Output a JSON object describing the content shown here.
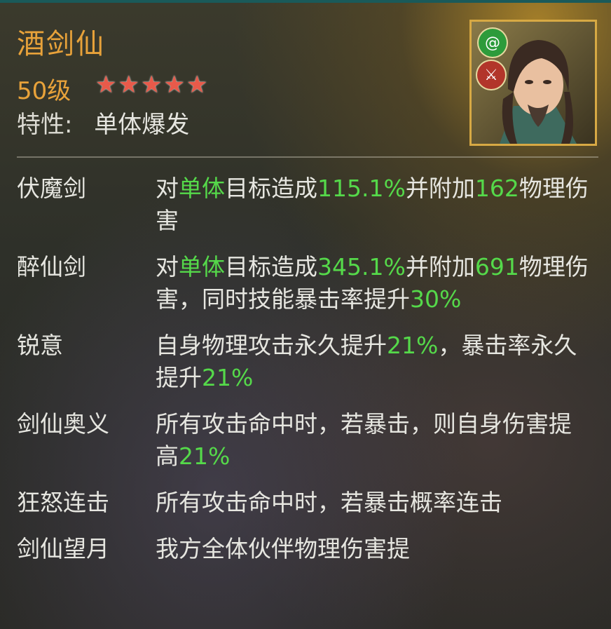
{
  "hero": {
    "name": "酒剑仙",
    "level": "50级",
    "stars": 5,
    "trait_label": "特性:",
    "trait_value": "单体爆发"
  },
  "portrait": {
    "badges": [
      "tornado-icon",
      "sword-icon"
    ]
  },
  "colors": {
    "name": "#e8a23a",
    "highlight": "#55d94a",
    "star": "#e85a4a",
    "text": "#e6e6e0",
    "frame": "#d7a944"
  },
  "skills": [
    {
      "name": "伏魔剑",
      "desc": [
        {
          "t": "对"
        },
        {
          "t": "单体",
          "hl": true
        },
        {
          "t": "目标造成"
        },
        {
          "t": "115.1%",
          "hl": true
        },
        {
          "t": "并附加"
        },
        {
          "t": "162",
          "hl": true
        },
        {
          "t": "物理伤害"
        }
      ]
    },
    {
      "name": "醉仙剑",
      "desc": [
        {
          "t": "对"
        },
        {
          "t": "单体",
          "hl": true
        },
        {
          "t": "目标造成"
        },
        {
          "t": "345.1%",
          "hl": true
        },
        {
          "t": "并附加"
        },
        {
          "t": "691",
          "hl": true
        },
        {
          "t": "物理伤害，同时技能暴击率提升"
        },
        {
          "t": "30%",
          "hl": true
        }
      ]
    },
    {
      "name": "锐意",
      "desc": [
        {
          "t": "自身物理攻击永久提升"
        },
        {
          "t": "21%",
          "hl": true
        },
        {
          "t": "，暴击率永久提升"
        },
        {
          "t": "21%",
          "hl": true
        }
      ]
    },
    {
      "name": "剑仙奥义",
      "desc": [
        {
          "t": "所有攻击命中时，若暴击，则自身伤害提高"
        },
        {
          "t": "21%",
          "hl": true
        }
      ]
    },
    {
      "name": "狂怒连击",
      "desc": [
        {
          "t": "所有攻击命中时，若暴击概率连击"
        }
      ]
    },
    {
      "name": "剑仙望月",
      "desc": [
        {
          "t": "我方全体伙伴物理伤害提"
        }
      ]
    }
  ]
}
